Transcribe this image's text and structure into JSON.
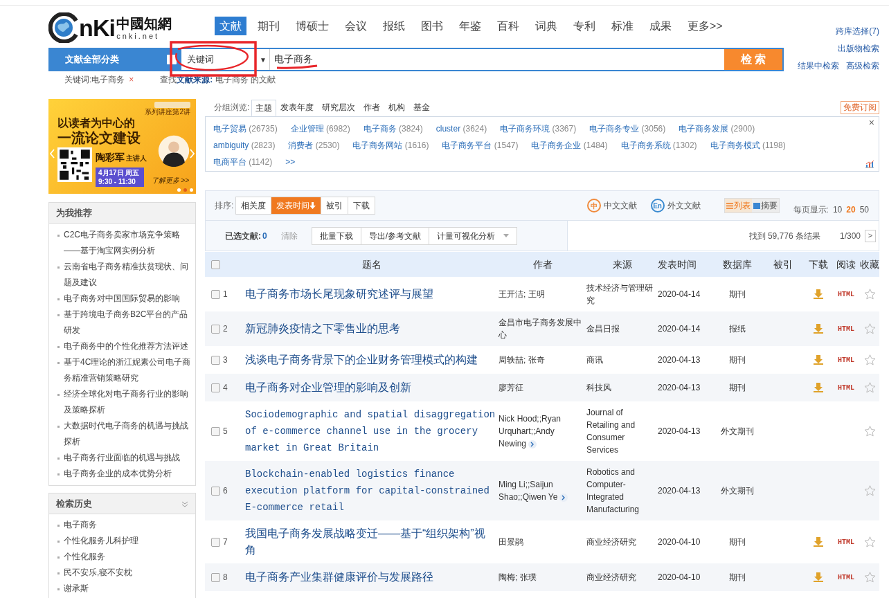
{
  "logo": {
    "mark": "nKi",
    "name": "中國知網",
    "domain": "cnki.net"
  },
  "nav": [
    {
      "label": "文献",
      "selected": true
    },
    {
      "label": "期刊",
      "selected": false
    },
    {
      "label": "博硕士",
      "selected": false
    },
    {
      "label": "会议",
      "selected": false
    },
    {
      "label": "报纸",
      "selected": false
    },
    {
      "label": "图书",
      "selected": false
    },
    {
      "label": "年鉴",
      "selected": false
    },
    {
      "label": "百科",
      "selected": false
    },
    {
      "label": "词典",
      "selected": false
    },
    {
      "label": "专利",
      "selected": false
    },
    {
      "label": "标准",
      "selected": false
    },
    {
      "label": "成果",
      "selected": false
    },
    {
      "label": "更多>>",
      "selected": false
    }
  ],
  "side_links": [
    "跨库选择(7)",
    "出版物检索"
  ],
  "side_links_row": [
    "结果中检索",
    "高级检索"
  ],
  "search": {
    "category": "文献全部分类",
    "field": "关键词",
    "caret": "▼",
    "value": "电子商务",
    "button": "检 索"
  },
  "crumbs": {
    "filter": "关键词:电子商务",
    "remove": "×",
    "hint": "查找**文献来源:** 电子商务 的文献"
  },
  "ad": {
    "series": "系列讲座第2讲",
    "title_1": "以读者为中心的",
    "title_2": "一流论文建设",
    "speaker": "陶彩军",
    "role": "主讲人",
    "date": "4月17日 周五",
    "time": "9:30 - 11:30",
    "more": "了解更多 >>"
  },
  "recommend": {
    "title": "为我推荐",
    "items": [
      "C2C电子商务卖家市场竞争策略——基于淘宝网实例分析",
      "云南省电子商务精准扶贫现状、问题及建议",
      "电子商务对中国国际贸易的影响",
      "基于跨境电子商务B2C平台的产品研发",
      "电子商务中的个性化推荐方法评述",
      "基于4C理论的浙江妮素公司电子商务精准营销策略研究",
      "经济全球化对电子商务行业的影响及策略探析",
      "大数据时代电子商务的机遇与挑战探析",
      "电子商务行业面临的机遇与挑战",
      "电子商务企业的成本优势分析"
    ]
  },
  "history": {
    "title": "检索历史",
    "items": [
      "电子商务",
      "个性化服务儿科护理",
      "个性化服务",
      "民不安乐,寝不安枕",
      "谢承斯"
    ]
  },
  "group": {
    "label": "分组浏览:",
    "tabs": [
      {
        "label": "主题",
        "selected": true
      },
      {
        "label": "发表年度",
        "selected": false
      },
      {
        "label": "研究层次",
        "selected": false
      },
      {
        "label": "作者",
        "selected": false
      },
      {
        "label": "机构",
        "selected": false
      },
      {
        "label": "基金",
        "selected": false
      }
    ],
    "subscribe": "免费订阅",
    "close": "×",
    "more": ">>",
    "topics": [
      {
        "name": "电子贸易",
        "count": "(26735)"
      },
      {
        "name": "企业管理",
        "count": "(6982)"
      },
      {
        "name": "电子商务",
        "count": "(3824)"
      },
      {
        "name": "cluster",
        "count": "(3624)"
      },
      {
        "name": "电子商务环境",
        "count": "(3367)"
      },
      {
        "name": "电子商务专业",
        "count": "(3056)"
      },
      {
        "name": "电子商务发展",
        "count": "(2900)"
      },
      {
        "name": "ambiguity",
        "count": "(2823)"
      },
      {
        "name": "消费者",
        "count": "(2530)"
      },
      {
        "name": "电子商务网站",
        "count": "(1616)"
      },
      {
        "name": "电子商务平台",
        "count": "(1547)"
      },
      {
        "name": "电子商务企业",
        "count": "(1484)"
      },
      {
        "name": "电子商务系统",
        "count": "(1302)"
      },
      {
        "name": "电子商务模式",
        "count": "(1198)"
      },
      {
        "name": "电商平台",
        "count": "(1142)"
      }
    ]
  },
  "sort": {
    "label": "排序:",
    "options": [
      {
        "label": "相关度",
        "selected": false
      },
      {
        "label": "发表时间",
        "selected": true
      },
      {
        "label": "被引",
        "selected": false
      },
      {
        "label": "下载",
        "selected": false
      }
    ]
  },
  "lang_filters": [
    {
      "icon_text": "中",
      "label": "中文文献",
      "color": "#f08a3c"
    },
    {
      "icon_text": "En",
      "label": "外文文献",
      "color": "#3a8ad0"
    }
  ],
  "views": [
    {
      "label": "列表",
      "selected": true
    },
    {
      "label": "摘要",
      "selected": false
    }
  ],
  "page_size": {
    "label": "每页显示:",
    "options": [
      {
        "label": "10",
        "selected": false
      },
      {
        "label": "20",
        "selected": true
      },
      {
        "label": "50",
        "selected": false
      }
    ]
  },
  "selection": {
    "label": "已选文献:",
    "count": "0",
    "clear": "清除",
    "actions": [
      "批量下载",
      "导出/参考文献",
      "计量可视化分析"
    ],
    "found": "找到 59,776 条结果",
    "page": "1/300",
    "next": ">"
  },
  "table": {
    "all_checked": false,
    "columns": [
      "题名",
      "作者",
      "来源",
      "发表时间",
      "数据库",
      "被引",
      "下载",
      "阅读",
      "收藏"
    ],
    "rows": [
      {
        "checked": false,
        "no": "1",
        "kind": "cn",
        "title": "电子商务市场长尾现象研究述评与展望",
        "authors": "王开洁; 王明",
        "more_authors": false,
        "source": "技术经济与管理研究",
        "date": "2020-04-14",
        "db": "期刊",
        "downloadable": true,
        "read": "HTML"
      },
      {
        "checked": false,
        "no": "2",
        "kind": "cn",
        "title": "新冠肺炎疫情之下零售业的思考",
        "authors": "金昌市电子商务发展中心",
        "more_authors": false,
        "source": "金昌日报",
        "date": "2020-04-14",
        "db": "报纸",
        "downloadable": true,
        "read": "HTML"
      },
      {
        "checked": false,
        "no": "3",
        "kind": "cn",
        "title": "浅谈电子商务背景下的企业财务管理模式的构建",
        "authors": "周轶喆; 张奇",
        "more_authors": false,
        "source": "商讯",
        "date": "2020-04-13",
        "db": "期刊",
        "downloadable": true,
        "read": "HTML"
      },
      {
        "checked": false,
        "no": "4",
        "kind": "cn",
        "title": "电子商务对企业管理的影响及创新",
        "authors": "廖芳征",
        "more_authors": false,
        "source": "科技风",
        "date": "2020-04-13",
        "db": "期刊",
        "downloadable": true,
        "read": "HTML"
      },
      {
        "checked": false,
        "no": "5",
        "kind": "foreign",
        "title": "Sociodemographic and spatial disaggregation of e-commerce channel use in the grocery market in Great Britain",
        "authors": "Nick Hood;;Ryan Urquhart;;Andy Newing",
        "more_authors": true,
        "source": "Journal of Retailing and Consumer Services",
        "date": "2020-04-13",
        "db": "外文期刊",
        "downloadable": false
      },
      {
        "checked": false,
        "no": "6",
        "kind": "foreign",
        "title": "Blockchain-enabled logistics finance execution platform for capital-constrained E-commerce retail",
        "authors": "Ming Li;;Saijun Shao;;Qiwen Ye",
        "more_authors": true,
        "source": "Robotics and Computer-Integrated Manufacturing",
        "date": "2020-04-13",
        "db": "外文期刊",
        "downloadable": false
      },
      {
        "checked": false,
        "no": "7",
        "kind": "cn",
        "title": "我国电子商务发展战略变迁——基于“组织架构”视角",
        "authors": "田景鹃",
        "more_authors": false,
        "source": "商业经济研究",
        "date": "2020-04-10",
        "db": "期刊",
        "downloadable": true,
        "read": "HTML"
      },
      {
        "checked": false,
        "no": "8",
        "kind": "cn",
        "title": "电子商务产业集群健康评价与发展路径",
        "authors": "陶梅; 张璞",
        "more_authors": false,
        "source": "商业经济研究",
        "date": "2020-04-10",
        "db": "期刊",
        "downloadable": true,
        "read": "HTML"
      }
    ]
  }
}
